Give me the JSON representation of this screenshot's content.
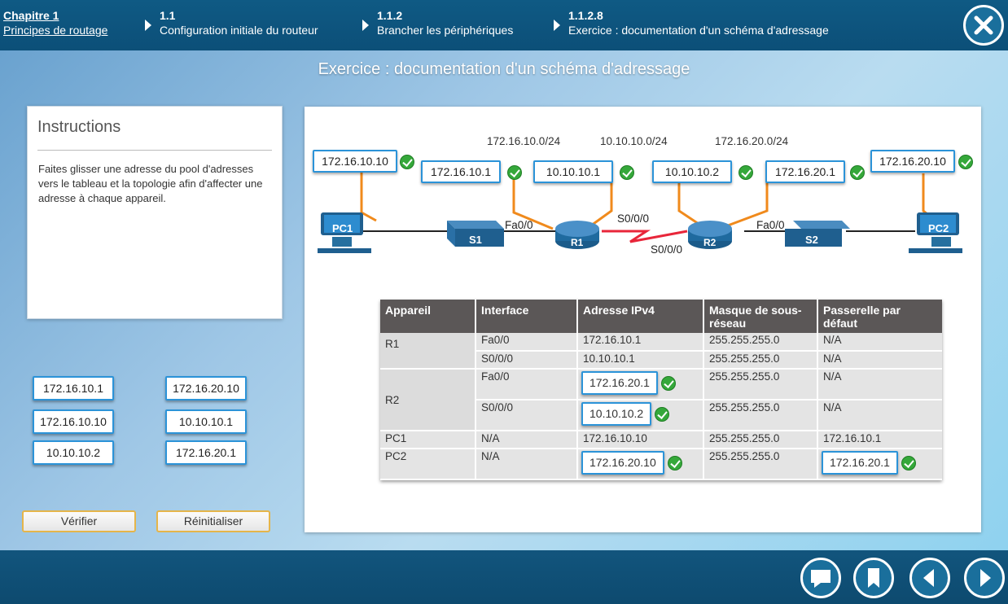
{
  "breadcrumb": [
    {
      "num": "Chapitre 1",
      "label": "Principes de routage"
    },
    {
      "num": "1.1",
      "label": "Configuration initiale du routeur"
    },
    {
      "num": "1.1.2",
      "label": "Brancher les périphériques"
    },
    {
      "num": "1.1.2.8",
      "label": "Exercice : documentation d'un schéma d'adressage"
    }
  ],
  "page_title": "Exercice : documentation d'un schéma d'adressage",
  "instructions": {
    "heading": "Instructions",
    "body": "Faites glisser une adresse du pool d'adresses vers le tableau et la topologie afin d'affecter une adresse à chaque appareil."
  },
  "pool": [
    "172.16.10.1",
    "172.16.20.10",
    "172.16.10.10",
    "10.10.10.1",
    "10.10.10.2",
    "172.16.20.1"
  ],
  "buttons": {
    "verify": "Vérifier",
    "reset": "Réinitialiser"
  },
  "topology": {
    "networks": [
      "172.16.10.0/24",
      "10.10.10.0/24",
      "172.16.20.0/24"
    ],
    "addresses": [
      "172.16.10.10",
      "172.16.10.1",
      "10.10.10.1",
      "10.10.10.2",
      "172.16.20.1",
      "172.16.20.10"
    ],
    "devices": {
      "pc1": "PC1",
      "s1": "S1",
      "r1": "R1",
      "r2": "R2",
      "s2": "S2",
      "pc2": "PC2"
    },
    "interfaces": {
      "r1_fa": "Fa0/0",
      "r1_s": "S0/0/0",
      "r2_s": "S0/0/0",
      "r2_fa": "Fa0/0"
    }
  },
  "table": {
    "headers": [
      "Appareil",
      "Interface",
      "Adresse IPv4",
      "Masque de sous-réseau",
      "Passerelle par défaut"
    ],
    "rows": [
      {
        "device": "R1",
        "interface": "Fa0/0",
        "ipv4": "172.16.10.1",
        "mask": "255.255.255.0",
        "gateway": "N/A"
      },
      {
        "device": "",
        "interface": "S0/0/0",
        "ipv4": "10.10.10.1",
        "mask": "255.255.255.0",
        "gateway": "N/A"
      },
      {
        "device": "R2",
        "interface": "Fa0/0",
        "ipv4": "172.16.20.1",
        "mask": "255.255.255.0",
        "gateway": "N/A"
      },
      {
        "device": "",
        "interface": "S0/0/0",
        "ipv4": "10.10.10.2",
        "mask": "255.255.255.0",
        "gateway": "N/A"
      },
      {
        "device": "PC1",
        "interface": "N/A",
        "ipv4": "172.16.10.10",
        "mask": "255.255.255.0",
        "gateway": "172.16.10.1"
      },
      {
        "device": "PC2",
        "interface": "N/A",
        "ipv4": "172.16.20.10",
        "mask": "255.255.255.0",
        "gateway": "172.16.20.1"
      }
    ]
  },
  "colors": {
    "accent": "#2b93d8",
    "check": "#35a83a",
    "header": "#0f5a84",
    "cable": "#f08a1c",
    "serial": "#e8263a"
  },
  "footer_icons": [
    "comment-icon",
    "bookmark-icon",
    "previous-icon",
    "next-icon"
  ]
}
